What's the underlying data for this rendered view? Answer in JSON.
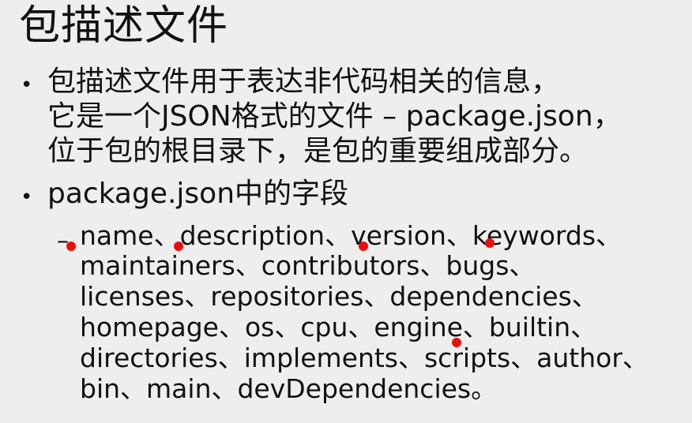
{
  "title": "包描述文件",
  "bullets": [
    {
      "marker": "•",
      "lines": [
        "包描述文件用于表达非代码相关的信息，",
        "它是一个JSON格式的文件 – package.json，",
        "位于包的根目录下，是包的重要组成部分。"
      ]
    },
    {
      "marker": "•",
      "lines": [
        "package.json中的字段"
      ],
      "sub": {
        "marker": "–",
        "lines": [
          "name、description、version、keywords、",
          "maintainers、contributors、bugs、",
          "licenses、repositories、dependencies、",
          "homepage、os、cpu、engine、builtin、",
          "directories、implements、scripts、author、",
          "bin、main、devDependencies。"
        ]
      }
    }
  ],
  "annotation_color": "#e8100c"
}
